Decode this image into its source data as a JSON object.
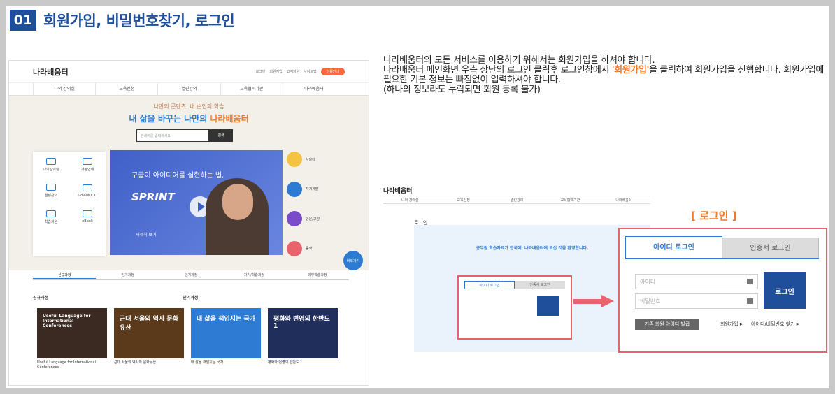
{
  "header": {
    "number": "01",
    "title": "회원가입, 비밀번호찾기, 로그인"
  },
  "description": {
    "line1": "나라배움터의 모든 서비스를 이용하기 위해서는 회원가입을 하셔야 합니다.",
    "line2_a": "나라배움터 메인화면 우측 상단의 로그인 클릭후 로그인창에서 ",
    "line2_b": "'회원가입'",
    "line2_c": "을 클릭하여 회원가입을 진행합니다. 회원가입에 필요한 기본 정보는 빠짐없이 입력하셔야 합니다.",
    "line3": "(하나의 정보라도 누락되면 회원 등록 불가)"
  },
  "site": {
    "logo": "나라배움터",
    "toplinks": [
      "로그인",
      "회원가입",
      "고객지원",
      "사이트맵"
    ],
    "top_button": "이용안내",
    "nav": [
      "나의 강의실",
      "교육신청",
      "열린강의",
      "교육협력기관",
      "나라배움터"
    ],
    "tagline": "나만의 콘텐츠, 내 손안의 학습",
    "headline_a": "내 삶을 바꾸는 나만의 ",
    "headline_b": "나라배움터",
    "search_placeholder": "검색어를 입력하세요",
    "search_button": "검색",
    "quick": [
      "나의강의실",
      "과정안내",
      "열린강의",
      "Gov-MOOC",
      "학습지원",
      "eBook"
    ],
    "video_title": "구글이 아이디어를 실현하는 법,",
    "video_sub": "SPRINT",
    "video_more": "자세히 보기",
    "categories": [
      "서울대",
      "자기계발",
      "인문/교양",
      "음악"
    ],
    "fab": "바로가기",
    "tabs": [
      "신규과정",
      "인기과정",
      "인기과정",
      "자기/학습과정",
      "외부학습과정"
    ],
    "lists": {
      "left": "신규과정",
      "right": "인기과정"
    },
    "books": [
      {
        "cover": "Useful Language for International Conferences",
        "title": "Useful Language for International Conferences",
        "color": "#3a2a22"
      },
      {
        "cover": "근대 서울의 역사 문화유산",
        "title": "근대 서울의 역사와 문화유산",
        "color": "#5a3a1a"
      },
      {
        "cover": "내 삶을 책임지는 국가",
        "title": "내 삶을 책임지는 국가",
        "color": "#2d7bd2"
      },
      {
        "cover": "평화와 번영의 한반도 1",
        "title": "평화와 번영의 한반도 1",
        "color": "#1f2e5a"
      }
    ]
  },
  "login_small": {
    "page": "로그인",
    "welcome": "공무원 학습자료가 한국에, 나라배움터에 오신 것을 환영합니다.",
    "tab1": "아이디 로그인",
    "tab2": "인증서 로그인"
  },
  "login_label": "[ 로그인 ]",
  "login": {
    "tab_id": "아이디 로그인",
    "tab_cert": "인증서 로그인",
    "id_placeholder": "아이디",
    "pw_placeholder": "비밀번호",
    "login_button": "로그인",
    "existing_button": "기존 회원 아이디 발급",
    "signup": "회원가입 ▸",
    "find": "아이디/비밀번호 찾기 ▸"
  }
}
